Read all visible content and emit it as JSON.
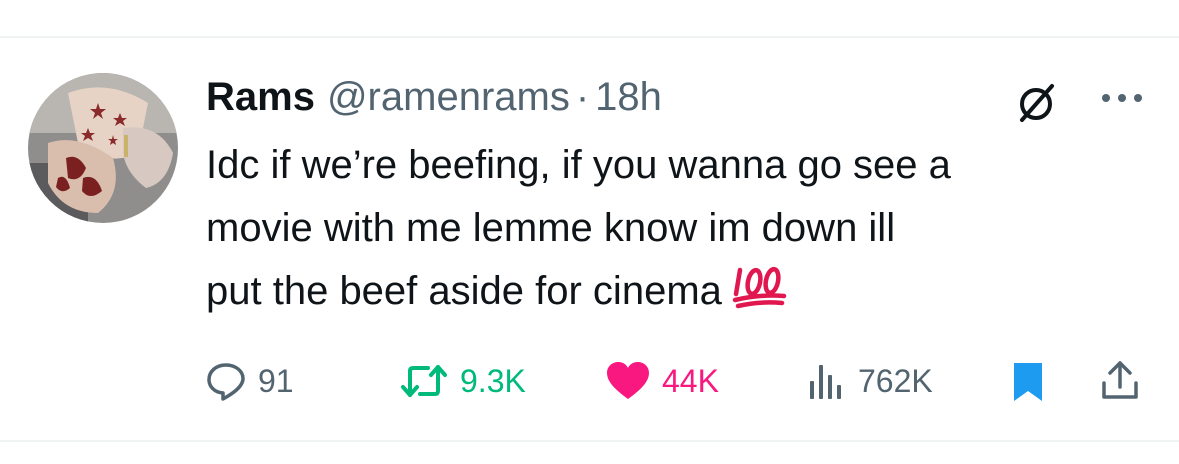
{
  "tweet": {
    "author": {
      "display_name": "Rams",
      "handle": "@ramenrams",
      "separator": "·",
      "time": "18h"
    },
    "text_lines": [
      "Idc if we’re beefing, if you wanna go see a",
      "movie with me lemme know im down ill",
      "put the beef aside for cinema"
    ],
    "emoji": "100",
    "actions": {
      "replies": "91",
      "retweets": "9.3K",
      "likes": "44K",
      "views": "762K"
    },
    "icons": {
      "reply": "reply-icon",
      "retweet": "retweet-icon",
      "like": "heart-icon",
      "views": "views-chart-icon",
      "bookmark": "bookmark-icon",
      "share": "share-icon",
      "grok": "grok-icon",
      "more": "more-icon"
    },
    "colors": {
      "text": "#0f1419",
      "secondary": "#536471",
      "retweet": "#00ba7c",
      "like": "#f91880",
      "bookmark": "#1d9bf0",
      "divider": "#eff3f4"
    }
  }
}
